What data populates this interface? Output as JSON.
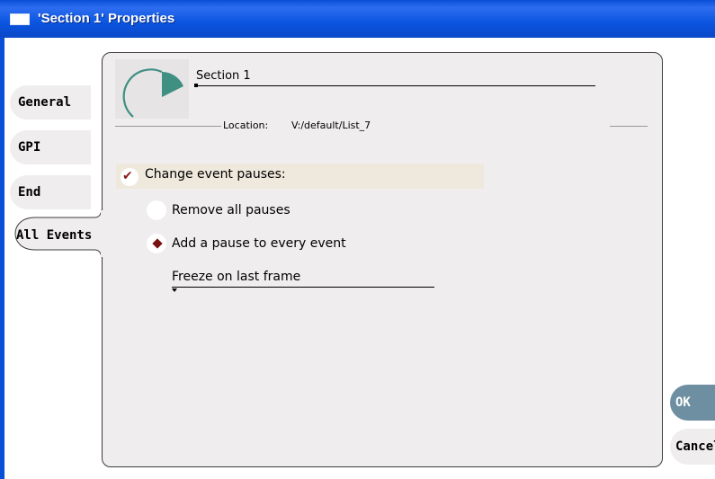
{
  "window": {
    "title": "'Section 1' Properties",
    "title_bar_color": "#0a4fd8"
  },
  "tabs": [
    {
      "label": "General",
      "active": false
    },
    {
      "label": "GPI",
      "active": false
    },
    {
      "label": "End",
      "active": false
    },
    {
      "label": "All Events",
      "active": true
    }
  ],
  "section": {
    "name": "Section 1",
    "location_label": "Location:",
    "location_value": "V:/default/List_7",
    "logo_icon": "pie-chart-icon"
  },
  "options": {
    "change_pauses": {
      "label": "Change event pauses:",
      "checked": true
    },
    "radios": [
      {
        "label": "Remove all pauses",
        "selected": false
      },
      {
        "label": "Add a pause to every event",
        "selected": true
      }
    ],
    "pause_mode": {
      "selected": "Freeze on last frame"
    }
  },
  "buttons": {
    "ok": "OK",
    "cancel": "Cancel"
  },
  "colors": {
    "panel": "#efedee",
    "ok_button": "#6e8fa2",
    "check_row": "#efe8dc",
    "accent_mark": "#7a1010"
  }
}
